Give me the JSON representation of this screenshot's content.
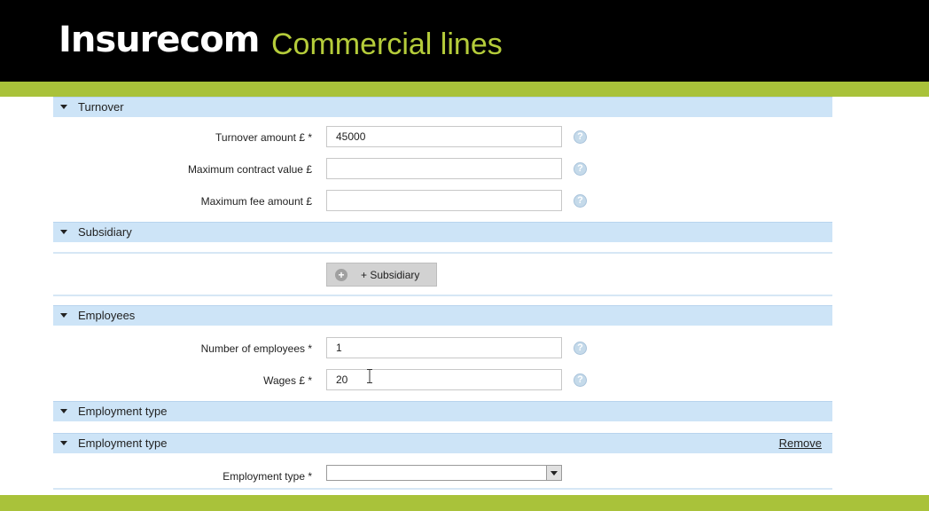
{
  "header": {
    "brand": "Insurecom",
    "subtitle": "Commercial lines"
  },
  "colors": {
    "accent": "#a9c23a",
    "section_bg": "#cde4f7",
    "header_bg": "#000000"
  },
  "sections": {
    "turnover": {
      "title": "Turnover",
      "fields": {
        "turnover_amount": {
          "label": "Turnover amount £ *",
          "value": "45000"
        },
        "max_contract": {
          "label": "Maximum contract value £",
          "value": ""
        },
        "max_fee": {
          "label": "Maximum fee amount £",
          "value": ""
        }
      }
    },
    "subsidiary": {
      "title": "Subsidiary",
      "button_label": "+ Subsidiary"
    },
    "employees": {
      "title": "Employees",
      "fields": {
        "num_employees": {
          "label": "Number of employees *",
          "value": "1"
        },
        "wages": {
          "label": "Wages £ *",
          "value": "20"
        }
      }
    },
    "employment_type_group": {
      "title": "Employment type"
    },
    "employment_type_item": {
      "title": "Employment type",
      "remove_label": "Remove",
      "fields": {
        "employment_type": {
          "label": "Employment type *",
          "value": ""
        }
      }
    }
  },
  "icons": {
    "help": "help-icon",
    "collapse": "collapse-arrow-icon",
    "add": "plus-circle-icon"
  }
}
